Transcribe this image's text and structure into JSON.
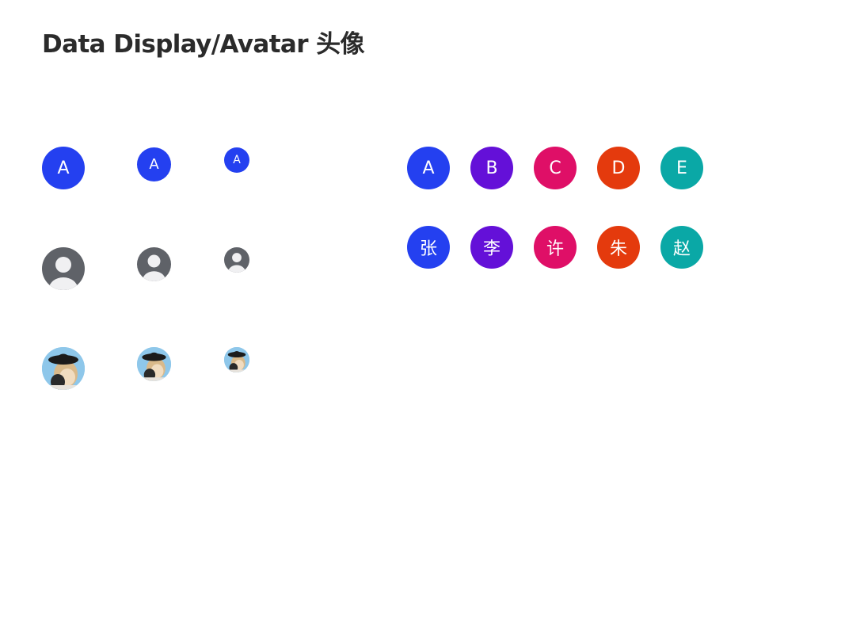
{
  "title": "Data Display/Avatar 头像",
  "size_demo": {
    "letter": "A",
    "letter_color": "#2440f0",
    "user_bg_color": "#5f6268",
    "user_icon_color": "#f0f0f2",
    "photo_bg_color": "#8ec7ea"
  },
  "letter_avatars": [
    {
      "text": "A",
      "color": "#2440f0"
    },
    {
      "text": "B",
      "color": "#6410d8"
    },
    {
      "text": "C",
      "color": "#df0f67"
    },
    {
      "text": "D",
      "color": "#e43a0d"
    },
    {
      "text": "E",
      "color": "#0aa8a6"
    }
  ],
  "name_avatars": [
    {
      "text": "张",
      "color": "#2440f0"
    },
    {
      "text": "李",
      "color": "#6410d8"
    },
    {
      "text": "许",
      "color": "#df0f67"
    },
    {
      "text": "朱",
      "color": "#e43a0d"
    },
    {
      "text": "赵",
      "color": "#0aa8a6"
    }
  ]
}
